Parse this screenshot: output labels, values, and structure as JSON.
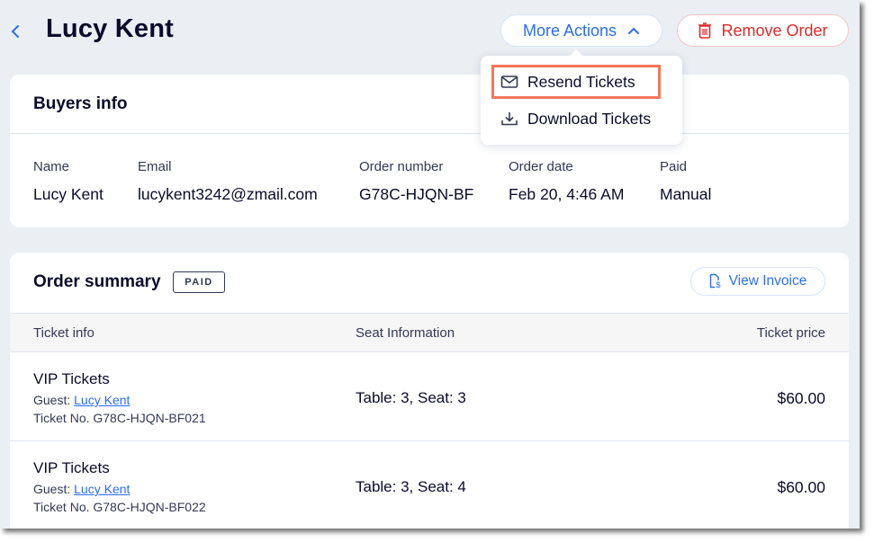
{
  "header": {
    "title": "Lucy Kent",
    "more_actions_label": "More Actions",
    "remove_order_label": "Remove Order"
  },
  "dropdown": {
    "items": [
      {
        "label": "Resend Tickets",
        "icon": "mail-icon",
        "highlighted": true
      },
      {
        "label": "Download Tickets",
        "icon": "download-icon",
        "highlighted": false
      }
    ]
  },
  "buyers": {
    "title": "Buyers info",
    "fields": [
      {
        "label": "Name",
        "value": "Lucy Kent"
      },
      {
        "label": "Email",
        "value": "lucykent3242@zmail.com"
      },
      {
        "label": "Order number",
        "value": "G78C-HJQN-BF"
      },
      {
        "label": "Order date",
        "value": "Feb 20, 4:46 AM"
      },
      {
        "label": "Paid",
        "value": "Manual"
      }
    ]
  },
  "order": {
    "title": "Order summary",
    "status_badge": "PAID",
    "view_invoice_label": "View Invoice",
    "columns": [
      "Ticket info",
      "Seat Information",
      "Ticket price"
    ],
    "rows": [
      {
        "ticket": "VIP Tickets",
        "guest_label": "Guest:",
        "guest_name": "Lucy Kent",
        "ticket_no": "Ticket No. G78C-HJQN-BF021",
        "seat": "Table: 3, Seat: 3",
        "price": "$60.00"
      },
      {
        "ticket": "VIP Tickets",
        "guest_label": "Guest:",
        "guest_name": "Lucy Kent",
        "ticket_no": "Ticket No. G78C-HJQN-BF022",
        "seat": "Table: 3, Seat: 4",
        "price": "$60.00"
      }
    ]
  },
  "colors": {
    "accent": "#2a6df4",
    "danger": "#e02a2a",
    "highlight": "#f2765a",
    "background": "#ebeef3"
  }
}
